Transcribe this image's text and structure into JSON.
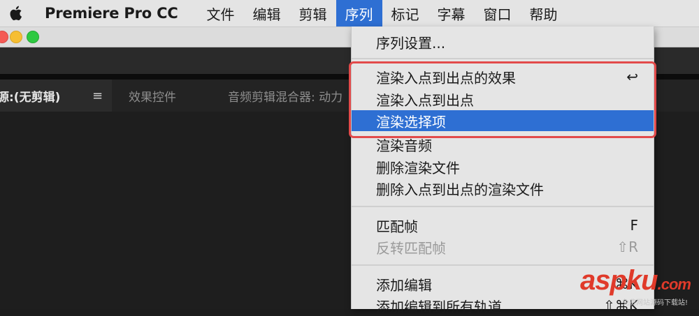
{
  "menubar": {
    "app_name": "Premiere Pro CC",
    "items": [
      "文件",
      "编辑",
      "剪辑",
      "序列",
      "标记",
      "字幕",
      "窗口",
      "帮助"
    ],
    "active": "序列"
  },
  "panel": {
    "tabs": [
      {
        "label": "源:(无剪辑)",
        "active": true
      },
      {
        "label": "效果控件",
        "active": false
      },
      {
        "label": "音频剪辑混合器: 动力",
        "active": false
      }
    ],
    "menu_glyph": "≡"
  },
  "dropdown": {
    "items": [
      {
        "label": "序列设置...",
        "shortcut": ""
      },
      {
        "label": "渲染入点到出点的效果",
        "shortcut": "↩"
      },
      {
        "label": "渲染入点到出点",
        "shortcut": ""
      },
      {
        "label": "渲染选择项",
        "shortcut": "",
        "selected": true
      },
      {
        "label": "渲染音频",
        "shortcut": ""
      },
      {
        "label": "删除渲染文件",
        "shortcut": ""
      },
      {
        "label": "删除入点到出点的渲染文件",
        "shortcut": ""
      },
      {
        "label": "匹配帧",
        "shortcut": "F"
      },
      {
        "label": "反转匹配帧",
        "shortcut": "⇧R",
        "disabled": true
      },
      {
        "label": "添加编辑",
        "shortcut": "⌘K"
      },
      {
        "label": "添加编辑到所有轨道",
        "shortcut": "⇧⌘K"
      }
    ]
  },
  "colors": {
    "accent": "#2e6fd3",
    "highlight_border": "#e24a4a"
  },
  "watermark": {
    "logo": "aspku",
    "logo_suffix": ".com",
    "subtitle": "免费网站源码下载站!"
  },
  "icons": [
    "apple-icon",
    "close-window-icon",
    "minimize-window-icon",
    "zoom-window-icon",
    "panel-menu-icon"
  ]
}
